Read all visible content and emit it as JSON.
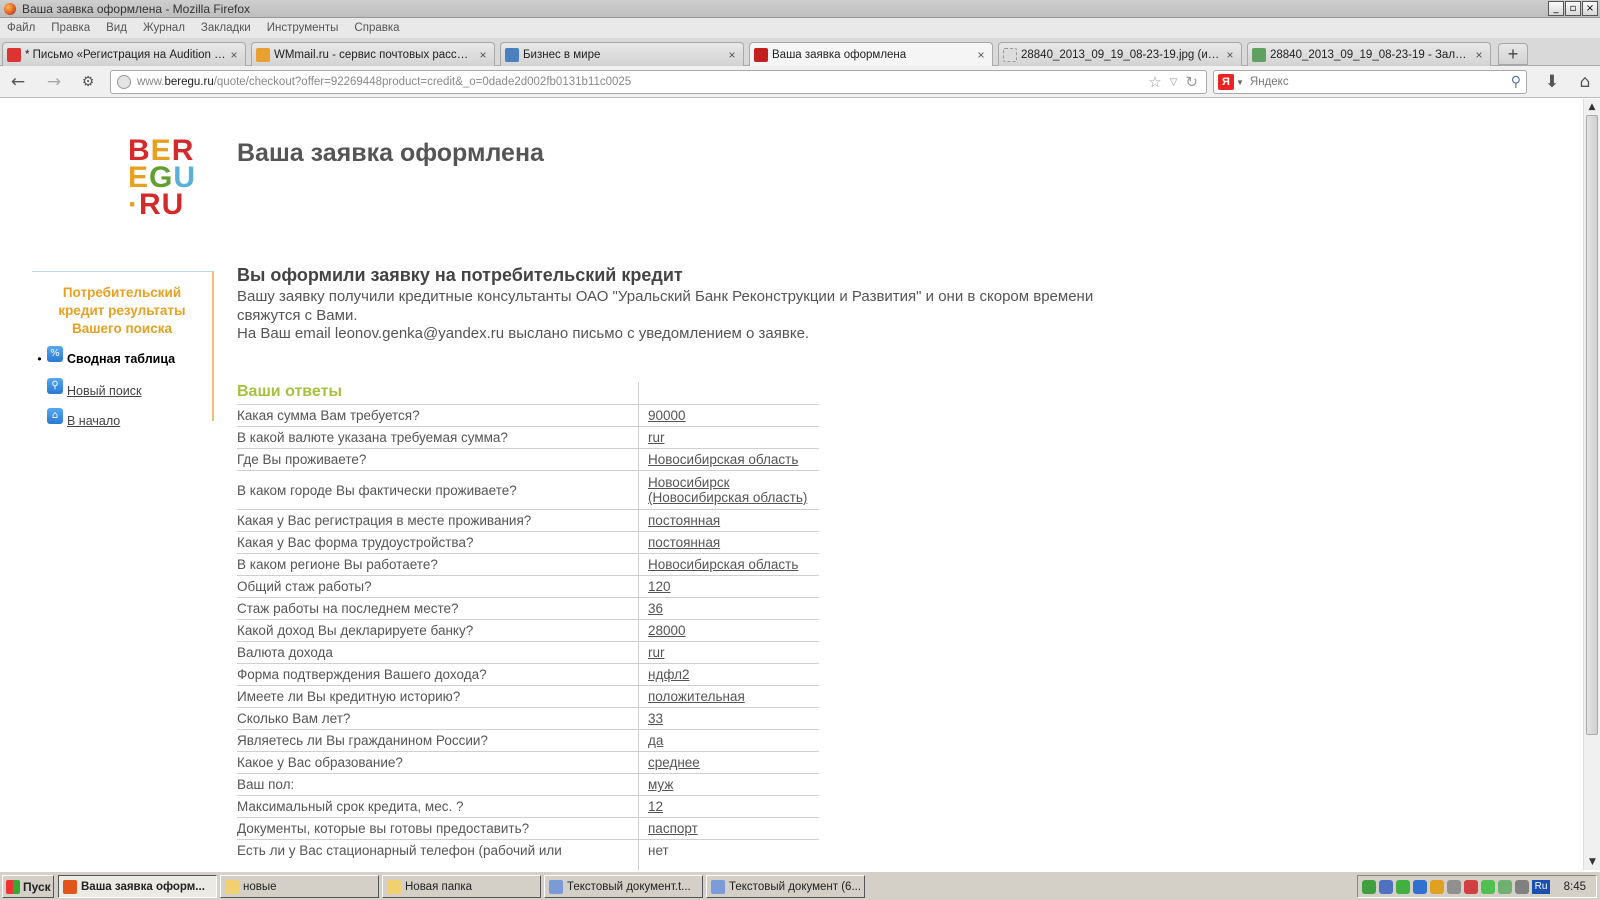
{
  "window": {
    "title": "Ваша заявка оформлена - Mozilla Firefox",
    "buttons": [
      "_",
      "▫",
      "×"
    ]
  },
  "menu": [
    "Файл",
    "Правка",
    "Вид",
    "Журнал",
    "Закладки",
    "Инструменты",
    "Справка"
  ],
  "tabs": [
    {
      "label": "* Письмо «Регистрация на Audition 2» ...",
      "icon_color": "#d33"
    },
    {
      "label": "WMmail.ru - сервис почтовых рассылок...",
      "icon_color": "#e8a030"
    },
    {
      "label": "Бизнес в мире",
      "icon_color": "#4a80c0"
    },
    {
      "label": "Ваша заявка оформлена",
      "icon_color": "#c42020",
      "active": true
    },
    {
      "label": "28840_2013_09_19_08-23-19.jpg (изоб...",
      "icon_color": "#ddd"
    },
    {
      "label": "28840_2013_09_19_08-23-19 - Заливка...",
      "icon_color": "#60a060"
    }
  ],
  "newtab_label": "+",
  "nav": {
    "back_icon": "←",
    "forward_icon": "→",
    "url_prefix": "www.",
    "url_domain": "beregu.ru",
    "url_path": "/quote/checkout?offer=92269448product=credit&_o=0dade2d002fb0131b11c0025",
    "search_engine_letter": "Я",
    "search_placeholder": "Яндекс"
  },
  "page": {
    "logo_rows": [
      [
        {
          "t": "B",
          "c": "#d42a2a"
        },
        {
          "t": "E",
          "c": "#e8a020"
        },
        {
          "t": "R",
          "c": "#d42a2a"
        }
      ],
      [
        {
          "t": "E",
          "c": "#e8a020"
        },
        {
          "t": "G",
          "c": "#60a030"
        },
        {
          "t": "U",
          "c": "#5ab0d8"
        }
      ],
      [
        {
          "t": "·",
          "c": "#e8a020"
        },
        {
          "t": "R",
          "c": "#d42a2a"
        },
        {
          "t": "U",
          "c": "#d42a2a"
        }
      ]
    ],
    "heading": "Ваша заявка оформлена",
    "sidebar": {
      "title": "Потребительский кредит результаты Вашего поиска",
      "items": [
        {
          "label": "Сводная таблица",
          "icon": "%"
        },
        {
          "label": "Новый поиск",
          "icon": "⚲"
        },
        {
          "label": "В начало",
          "icon": "⌂"
        }
      ]
    },
    "content": {
      "heading": "Вы оформили заявку на потребительский кредит",
      "line1": "Вашу заявку получили кредитные консультанты ОАО \"Уральский Банк Реконструкции и Развития\" и они в скором времени свяжутся с Вами.",
      "line2": "На Ваш email leonov.genka@yandex.ru выслано письмо с уведомлением о заявке."
    },
    "answers_title": "Ваши ответы",
    "answers": [
      {
        "q": "Какая сумма Вам требуется?",
        "a": "90000"
      },
      {
        "q": "В какой валюте указана требуемая сумма?",
        "a": "rur"
      },
      {
        "q": "Где Вы проживаете?",
        "a": "Новосибирская область"
      },
      {
        "q": "В каком городе Вы фактически проживаете?",
        "a": "Новосибирск (Новосибирская область)"
      },
      {
        "q": "Какая у Вас регистрация в месте проживания?",
        "a": "постоянная"
      },
      {
        "q": "Какая у Вас форма трудоустройства?",
        "a": "постоянная"
      },
      {
        "q": "В каком регионе Вы работаете?",
        "a": "Новосибирская область"
      },
      {
        "q": "Общий стаж работы?",
        "a": "120"
      },
      {
        "q": "Стаж работы на последнем месте?",
        "a": "36"
      },
      {
        "q": "Какой доход Вы декларируете банку?",
        "a": "28000"
      },
      {
        "q": "Валюта дохода",
        "a": "rur"
      },
      {
        "q": "Форма подтверждения Вашего дохода?",
        "a": "ндфл2"
      },
      {
        "q": "Имеете ли Вы кредитную историю?",
        "a": "положительная"
      },
      {
        "q": "Сколько Вам лет?",
        "a": "33"
      },
      {
        "q": "Являетесь ли Вы гражданином России?",
        "a": "да"
      },
      {
        "q": "Какое у Вас образование?",
        "a": "среднее"
      },
      {
        "q": "Ваш пол:",
        "a": "муж"
      },
      {
        "q": "Максимальный срок кредита, мес. ?",
        "a": "12"
      },
      {
        "q": "Документы, которые вы готовы предоставить?",
        "a": "паспорт"
      },
      {
        "q": "Есть ли у Вас стационарный телефон (рабочий или",
        "a": "нет"
      }
    ]
  },
  "taskbar": {
    "start_label": "Пуск",
    "buttons": [
      {
        "label": "Ваша заявка оформ...",
        "icon_color": "#e0561a",
        "active": true
      },
      {
        "label": "новые",
        "icon_color": "#f0d070"
      },
      {
        "label": "Новая папка",
        "icon_color": "#f0d070"
      },
      {
        "label": "Текстовый документ.t...",
        "icon_color": "#7a9ad8"
      },
      {
        "label": "Текстовый документ (6...",
        "icon_color": "#7a9ad8"
      }
    ],
    "tray_icon_colors": [
      "#40a040",
      "#5070c0",
      "#40b040",
      "#3070d0",
      "#e0a020",
      "#909090",
      "#d04040",
      "#50c050",
      "#70b070",
      "#808080"
    ],
    "lang": "Ru",
    "clock": "8:45"
  }
}
